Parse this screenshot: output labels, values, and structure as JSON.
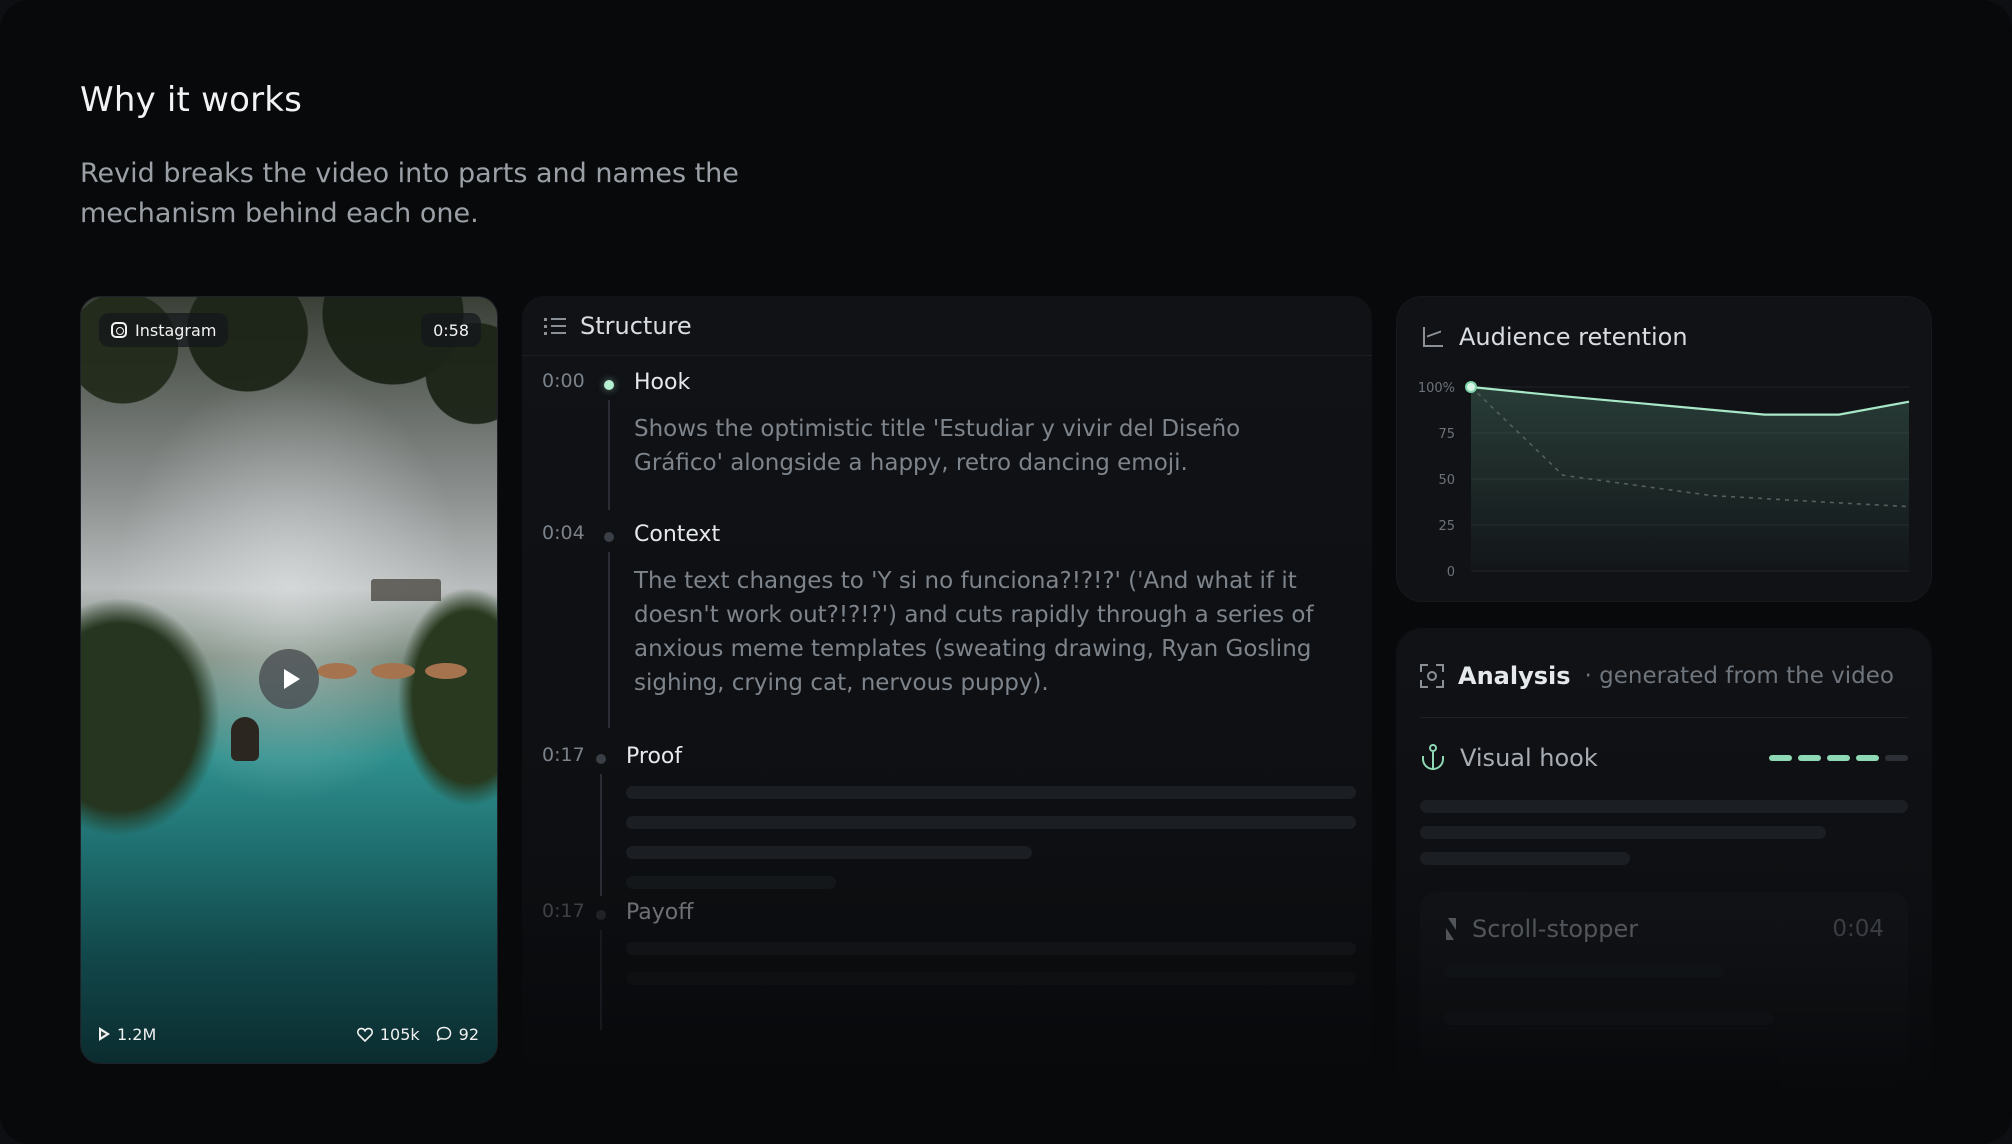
{
  "header": {
    "title": "Why it works",
    "subtitle": "Revid breaks the video into parts and names the mechanism behind each one."
  },
  "video": {
    "source": "Instagram",
    "source_icon": "instagram-icon",
    "duration": "0:58",
    "views": "1.2M",
    "likes": "105k",
    "comments": "92"
  },
  "structure": {
    "title": "Structure",
    "icon": "list-icon",
    "segments": [
      {
        "time": "0:00",
        "label": "Hook",
        "description": "Shows the optimistic title 'Estudiar y vivir del Diseño Gráfico' alongside a happy, retro dancing emoji.",
        "active": true
      },
      {
        "time": "0:04",
        "label": "Context",
        "description": "The text changes to 'Y si no funciona?!?!?' ('And what if it doesn't work out?!?!?') and cuts rapidly through a series of anxious meme templates (sweating drawing, Ryan Gosling sighing, crying cat, nervous puppy).",
        "active": false
      },
      {
        "time": "0:17",
        "label": "Proof",
        "active": false
      },
      {
        "time": "0:17",
        "label": "Payoff",
        "active": false
      }
    ]
  },
  "retention": {
    "title": "Audience retention",
    "icon": "chart-line-icon"
  },
  "chart_data": {
    "type": "line",
    "title": "Audience retention",
    "y_ticks": [
      "100%",
      "75",
      "50",
      "25",
      "0"
    ],
    "ylim": [
      0,
      100
    ],
    "x": [
      0,
      0.21,
      0.67,
      0.84,
      1.0
    ],
    "series": [
      {
        "values": [
          100,
          95,
          85,
          85,
          92
        ],
        "color": "#a8e8c8",
        "style": "solid"
      },
      {
        "values": [
          100,
          52,
          41,
          37,
          35
        ],
        "color": "#56605b",
        "style": "dashed",
        "x": [
          0,
          0.21,
          0.55,
          0.84,
          1.0
        ]
      }
    ],
    "grid": true,
    "legend": "none"
  },
  "analysis": {
    "title": "Analysis",
    "subtitle": "· generated from the video",
    "icon": "focus-icon",
    "visual_hook": {
      "label": "Visual hook",
      "icon": "anchor-icon",
      "score": 4,
      "max": 5
    },
    "scroll_stopper": {
      "label": "Scroll-stopper",
      "icon": "bolt-icon",
      "time": "0:04"
    }
  },
  "colors": {
    "accent": "#a8e8c8",
    "background": "#08090b",
    "panel": "#101216"
  }
}
